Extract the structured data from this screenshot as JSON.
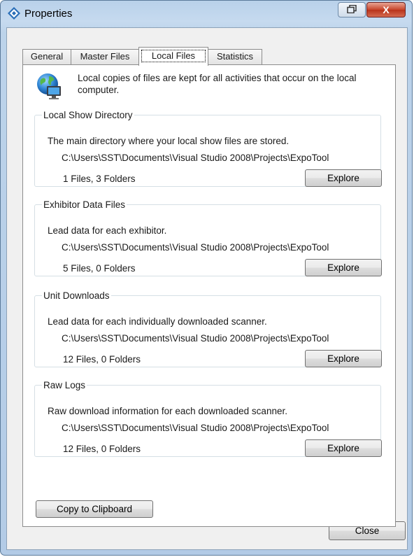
{
  "window": {
    "title": "Properties",
    "close_glyph": "X",
    "icon": "properties-diamond-icon",
    "colors": {
      "titlebar": "#c6daef",
      "close_button": "#c7442a",
      "client": "#f0f0f0"
    }
  },
  "tabs": [
    {
      "label": "General",
      "active": false
    },
    {
      "label": "Master Files",
      "active": false
    },
    {
      "label": "Local Files",
      "active": true
    },
    {
      "label": "Statistics",
      "active": false
    }
  ],
  "intro": {
    "icon": "globe-computer-icon",
    "text": "Local copies of files are kept for all activities that occur on the local computer."
  },
  "groups": [
    {
      "title": "Local Show Directory",
      "description": "The main directory where your local show files are stored.",
      "path": "C:\\Users\\SST\\Documents\\Visual Studio 2008\\Projects\\ExpoTool",
      "count": "1 Files, 3 Folders",
      "button": "Explore"
    },
    {
      "title": "Exhibitor Data Files",
      "description": "Lead data for each exhibitor.",
      "path": "C:\\Users\\SST\\Documents\\Visual Studio 2008\\Projects\\ExpoTool",
      "count": "5 Files, 0 Folders",
      "button": "Explore"
    },
    {
      "title": "Unit Downloads",
      "description": "Lead data for each individually downloaded scanner.",
      "path": "C:\\Users\\SST\\Documents\\Visual Studio 2008\\Projects\\ExpoTool",
      "count": "12 Files, 0 Folders",
      "button": "Explore"
    },
    {
      "title": "Raw Logs",
      "description": "Raw download information for each downloaded scanner.",
      "path": "C:\\Users\\SST\\Documents\\Visual Studio 2008\\Projects\\ExpoTool",
      "count": "12 Files, 0 Folders",
      "button": "Explore"
    }
  ],
  "buttons": {
    "copy": "Copy to Clipboard",
    "close": "Close"
  }
}
